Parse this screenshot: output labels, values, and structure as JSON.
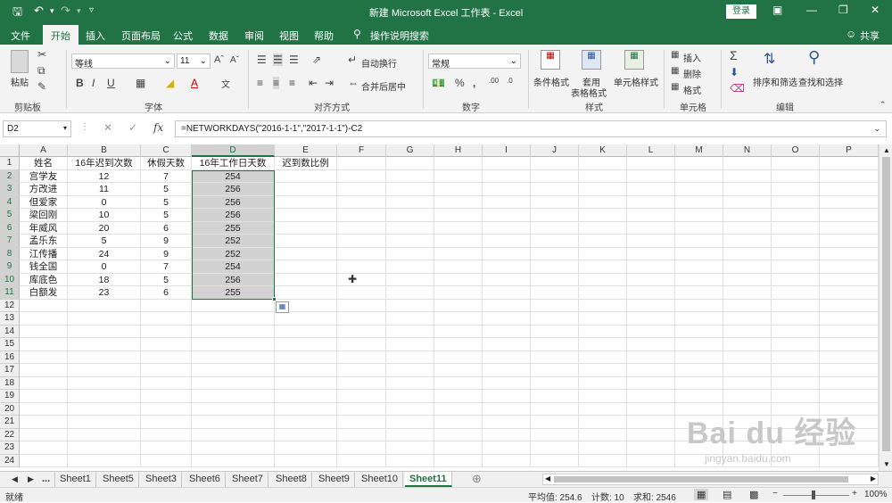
{
  "window": {
    "title": "新建 Microsoft Excel 工作表 - Excel",
    "login_label": "登录",
    "share_label": "共享"
  },
  "ribbon_tabs": [
    "文件",
    "开始",
    "插入",
    "页面布局",
    "公式",
    "数据",
    "审阅",
    "视图",
    "帮助",
    "操作说明搜索"
  ],
  "ribbon": {
    "paste_label": "粘贴",
    "clipboard_label": "剪贴板",
    "font_name": "等线",
    "font_size": "11",
    "font_label": "字体",
    "wrap_text_label": "自动换行",
    "merge_center_label": "合并后居中",
    "align_label": "对齐方式",
    "number_format": "常规",
    "number_label": "数字",
    "cond_format_label": "条件格式",
    "table_format_label1": "套用",
    "table_format_label2": "表格格式",
    "cell_style_label": "单元格样式",
    "style_label": "样式",
    "insert_label": "插入",
    "delete_label": "删除",
    "format_label": "格式",
    "cells_label": "单元格",
    "sort_filter_label": "排序和筛选",
    "find_select_label": "查找和选择",
    "edit_label": "编辑"
  },
  "formula_bar": {
    "name_box": "D2",
    "formula": "=NETWORKDAYS(\"2016-1-1\",\"2017-1-1\")-C2"
  },
  "columns": [
    "A",
    "B",
    "C",
    "D",
    "E",
    "F",
    "G",
    "H",
    "I",
    "J",
    "K",
    "L",
    "M",
    "N",
    "O",
    "P"
  ],
  "rows": [
    "1",
    "2",
    "3",
    "4",
    "5",
    "6",
    "7",
    "8",
    "9",
    "10",
    "11",
    "12",
    "13",
    "14",
    "15",
    "16",
    "17",
    "18",
    "19",
    "20",
    "21",
    "22",
    "23",
    "24"
  ],
  "headers": [
    "姓名",
    "16年迟到次数",
    "休假天数",
    "16年工作日天数",
    "迟到数比例"
  ],
  "table": [
    [
      "宫学友",
      "12",
      "7",
      "254"
    ],
    [
      "方改进",
      "11",
      "5",
      "256"
    ],
    [
      "但爱家",
      "0",
      "5",
      "256"
    ],
    [
      "梁回刚",
      "10",
      "5",
      "256"
    ],
    [
      "年威风",
      "20",
      "6",
      "255"
    ],
    [
      "孟乐东",
      "5",
      "9",
      "252"
    ],
    [
      "江传播",
      "24",
      "9",
      "252"
    ],
    [
      "钱全国",
      "0",
      "7",
      "254"
    ],
    [
      "库底色",
      "18",
      "5",
      "256"
    ],
    [
      "白额发",
      "23",
      "6",
      "255"
    ]
  ],
  "sheet_tabs": [
    "Sheet1",
    "Sheet5",
    "Sheet3",
    "Sheet6",
    "Sheet7",
    "Sheet8",
    "Sheet9",
    "Sheet10",
    "Sheet11"
  ],
  "sheet_more": "...",
  "status_bar": {
    "ready": "就绪",
    "average": "平均值: 254.6",
    "count": "计数: 10",
    "sum": "求和: 2546",
    "zoom": "100%"
  },
  "watermark": {
    "logo_text": "Bai du 经验",
    "url": "jingyan.baidu.com"
  },
  "colors": {
    "excel_green": "#217346",
    "selection_fill": "#d2d2d2"
  }
}
